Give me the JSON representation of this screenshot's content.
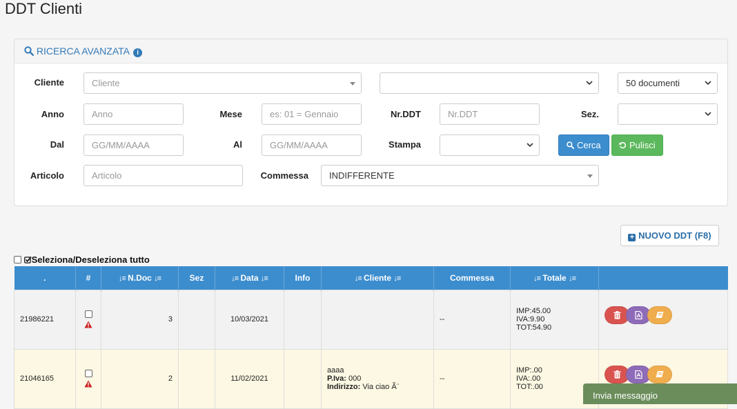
{
  "page": {
    "title": "DDT Clienti"
  },
  "search": {
    "heading": "RICERCA AVANZATA",
    "labels": {
      "cliente": "Cliente",
      "anno": "Anno",
      "mese": "Mese",
      "nrddt": "Nr.DDT",
      "sez": "Sez.",
      "dal": "Dal",
      "al": "Al",
      "stampa": "Stampa",
      "articolo": "Articolo",
      "commessa": "Commessa"
    },
    "placeholders": {
      "cliente": "Cliente",
      "anno": "Anno",
      "mese": "es: 01 = Gennaio",
      "nrddt": "Nr.DDT",
      "dal": "GG/MM/AAAA",
      "al": "GG/MM/AAAA",
      "articolo": "Articolo"
    },
    "values": {
      "documenti": "50 documenti",
      "commessa": "INDIFFERENTE"
    },
    "buttons": {
      "cerca": "Cerca",
      "pulisci": "Pulisci"
    }
  },
  "toolbar": {
    "new_ddt": "NUOVO DDT (F8)"
  },
  "table": {
    "select_all": "Seleziona/Deseleziona tutto",
    "headers": {
      "id": ".",
      "hash": "#",
      "ndoc": "N.Doc",
      "sez": "Sez",
      "data": "Data",
      "info": "Info",
      "cliente": "Cliente",
      "commessa": "Commessa",
      "totale": "Totale"
    },
    "rows": [
      {
        "id": "21986221",
        "ndoc": "3",
        "sez": "",
        "data": "10/03/2021",
        "info": "",
        "cliente_name": "",
        "piva_label": "",
        "piva": "",
        "indirizzo_label": "",
        "indirizzo": "",
        "commessa": "--",
        "imp": "IMP:45.00",
        "iva": "IVA:9.90",
        "tot": "TOT:54.90"
      },
      {
        "id": "21046165",
        "ndoc": "2",
        "sez": "",
        "data": "11/02/2021",
        "info": "",
        "cliente_name": "aaaa",
        "piva_label": "P.Iva:",
        "piva": "000",
        "indirizzo_label": "Indirizzo:",
        "indirizzo": "Via ciao Ã¨",
        "commessa": "--",
        "imp": "IMP:.00",
        "iva": "IVA:.00",
        "tot": "TOT:.00"
      }
    ]
  },
  "message": {
    "label": "Invia messaggio"
  },
  "colors": {
    "primary": "#3c8dce",
    "success": "#5cb85c",
    "danger": "#d9534f",
    "purple": "#8e6bb8",
    "warning": "#f0ad4e",
    "row_highlight": "#fcf8e3"
  },
  "icons": [
    "search-icon",
    "info-icon",
    "chevron-down-icon",
    "refresh-icon",
    "plus-square-icon",
    "checkbox-icon",
    "sort-icon",
    "warning-icon",
    "trash-icon",
    "pdf-icon",
    "book-icon"
  ]
}
